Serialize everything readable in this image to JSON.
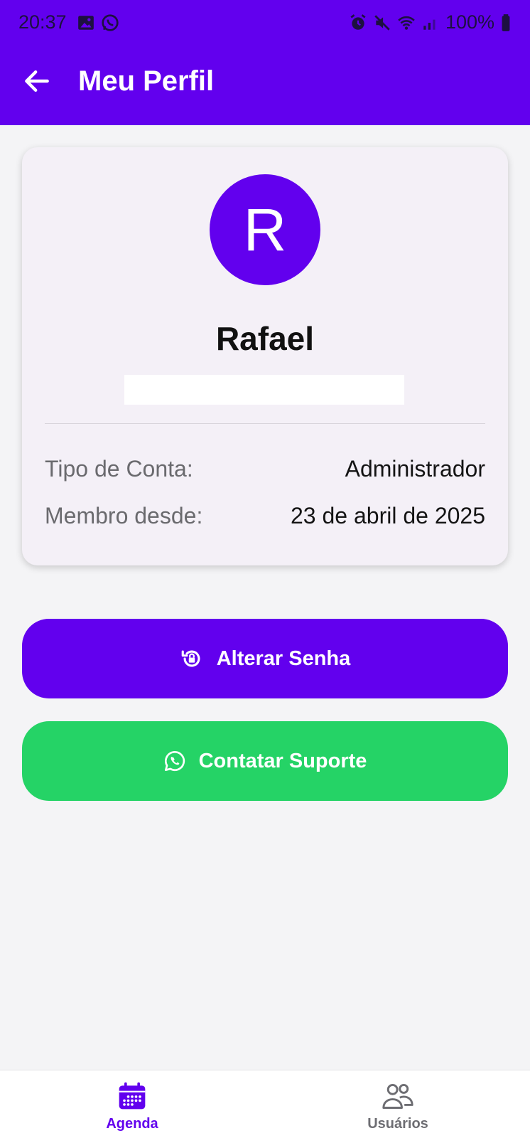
{
  "status_bar": {
    "time": "20:37",
    "battery": "100%",
    "left_icons": [
      "image-icon",
      "whatsapp-icon"
    ],
    "right_icons": [
      "alarm-icon",
      "mute-icon",
      "wifi-icon",
      "signal-icon",
      "battery-icon"
    ]
  },
  "header": {
    "title": "Meu Perfil",
    "back_icon": "arrow-left-icon"
  },
  "profile": {
    "avatar_initial": "R",
    "name": "Rafael",
    "details": [
      {
        "label": "Tipo de Conta:",
        "value": "Administrador"
      },
      {
        "label": "Membro desde:",
        "value": "23 de abril de 2025"
      }
    ]
  },
  "actions": {
    "change_password": {
      "label": "Alterar Senha",
      "icon": "lock-reset-icon"
    },
    "contact_support": {
      "label": "Contatar Suporte",
      "icon": "whatsapp-icon"
    }
  },
  "bottom_nav": {
    "items": [
      {
        "label": "Agenda",
        "icon": "calendar-icon",
        "active": true
      },
      {
        "label": "Usuários",
        "icon": "users-icon",
        "active": false
      }
    ]
  },
  "colors": {
    "primary": "#6200ee",
    "whatsapp_green": "#25d366",
    "background": "#f4f4f6",
    "card": "#f4f0f7",
    "nav_active": "#6200ee",
    "nav_inactive": "#6d6d72"
  }
}
